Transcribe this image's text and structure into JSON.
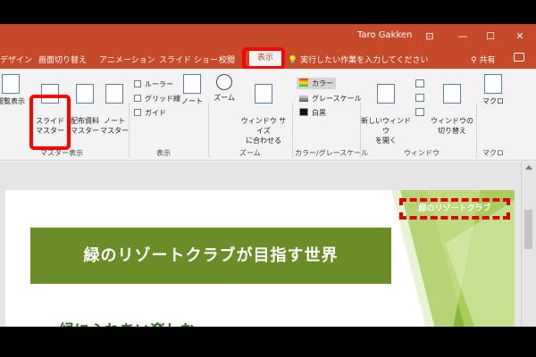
{
  "window": {
    "user": "Taro Gakken",
    "controls": [
      "⊡",
      "—",
      "☐",
      "✕"
    ]
  },
  "tabs": [
    {
      "label": "デザイン"
    },
    {
      "label": "画面切り替え"
    },
    {
      "label": "アニメーション"
    },
    {
      "label": "スライド ショー"
    },
    {
      "label": "校閲"
    }
  ],
  "active_tab": "表示",
  "tellme": "実行したい作業を入力してください",
  "share": "共有",
  "ribbon": {
    "master_view": {
      "partial_label": "閲覧表示",
      "slide_master": "スライド\nマスター",
      "handout_master": "配布資料\nマスター",
      "notes_master": "ノート\nマスター",
      "group": "マスター表示"
    },
    "show": {
      "ruler": "ルーラー",
      "gridlines": "グリッド線",
      "guides": "ガイド",
      "notes": "ノート",
      "group": "表示"
    },
    "zoom": {
      "zoom": "ズーム",
      "fit": "ウィンドウ サイズ\nに合わせる",
      "group": "ズーム"
    },
    "color": {
      "color": "カラー",
      "grayscale": "グレースケール",
      "bw": "白黒",
      "group": "カラー/グレースケール"
    },
    "window": {
      "new_window": "新しいウィンドウ\nを開く",
      "switch": "ウィンドウの\n切り替え",
      "group": "ウィンドウ"
    },
    "macro": {
      "macro": "マクロ",
      "group": "マクロ"
    }
  },
  "slide": {
    "title": "緑のリゾートクラブが目指す世界",
    "bullet": "緑にふれあい楽しむ",
    "logo": "緑のリゾートクラブ"
  },
  "colors": {
    "titlebar": "#c6492a",
    "slide_green": "#6b8d28",
    "highlight": "#ff0000"
  }
}
